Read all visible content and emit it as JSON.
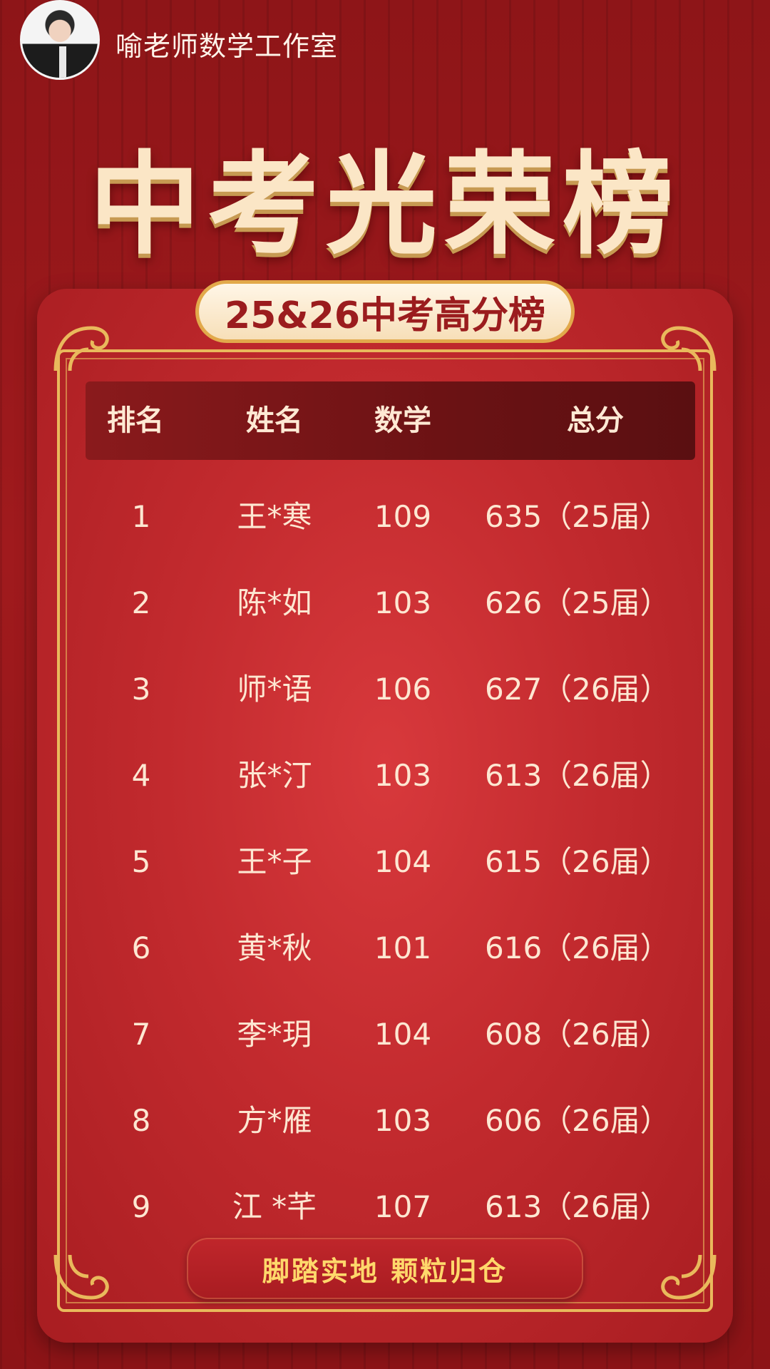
{
  "header": {
    "studio_name": "喻老师数学工作室"
  },
  "title": "中考光荣榜",
  "subtitle": "25&26中考高分榜",
  "table": {
    "headers": [
      "排名",
      "姓名",
      "数学",
      "总分"
    ],
    "rows": [
      {
        "rank": "1",
        "name": "王*寒",
        "math": "109",
        "total": "635（25届）"
      },
      {
        "rank": "2",
        "name": "陈*如",
        "math": "103",
        "total": "626（25届）"
      },
      {
        "rank": "3",
        "name": "师*语",
        "math": "106",
        "total": "627（26届）"
      },
      {
        "rank": "4",
        "name": "张*汀",
        "math": "103",
        "total": "613（26届）"
      },
      {
        "rank": "5",
        "name": "王*子",
        "math": "104",
        "total": "615（26届）"
      },
      {
        "rank": "6",
        "name": "黄*秋",
        "math": "101",
        "total": "616（26届）"
      },
      {
        "rank": "7",
        "name": "李*玥",
        "math": "104",
        "total": "608（26届）"
      },
      {
        "rank": "8",
        "name": "方*雁",
        "math": "103",
        "total": "606（26届）"
      },
      {
        "rank": "9",
        "name": "江 *芊",
        "math": "107",
        "total": "613（26届）"
      }
    ]
  },
  "slogan": "脚踏实地  颗粒归仓",
  "colors": {
    "background": "#9a181b",
    "board": "#c52c30",
    "gold": "#e9b95c",
    "header_row": "#6b1214",
    "slogan_text": "#ffd86b"
  }
}
